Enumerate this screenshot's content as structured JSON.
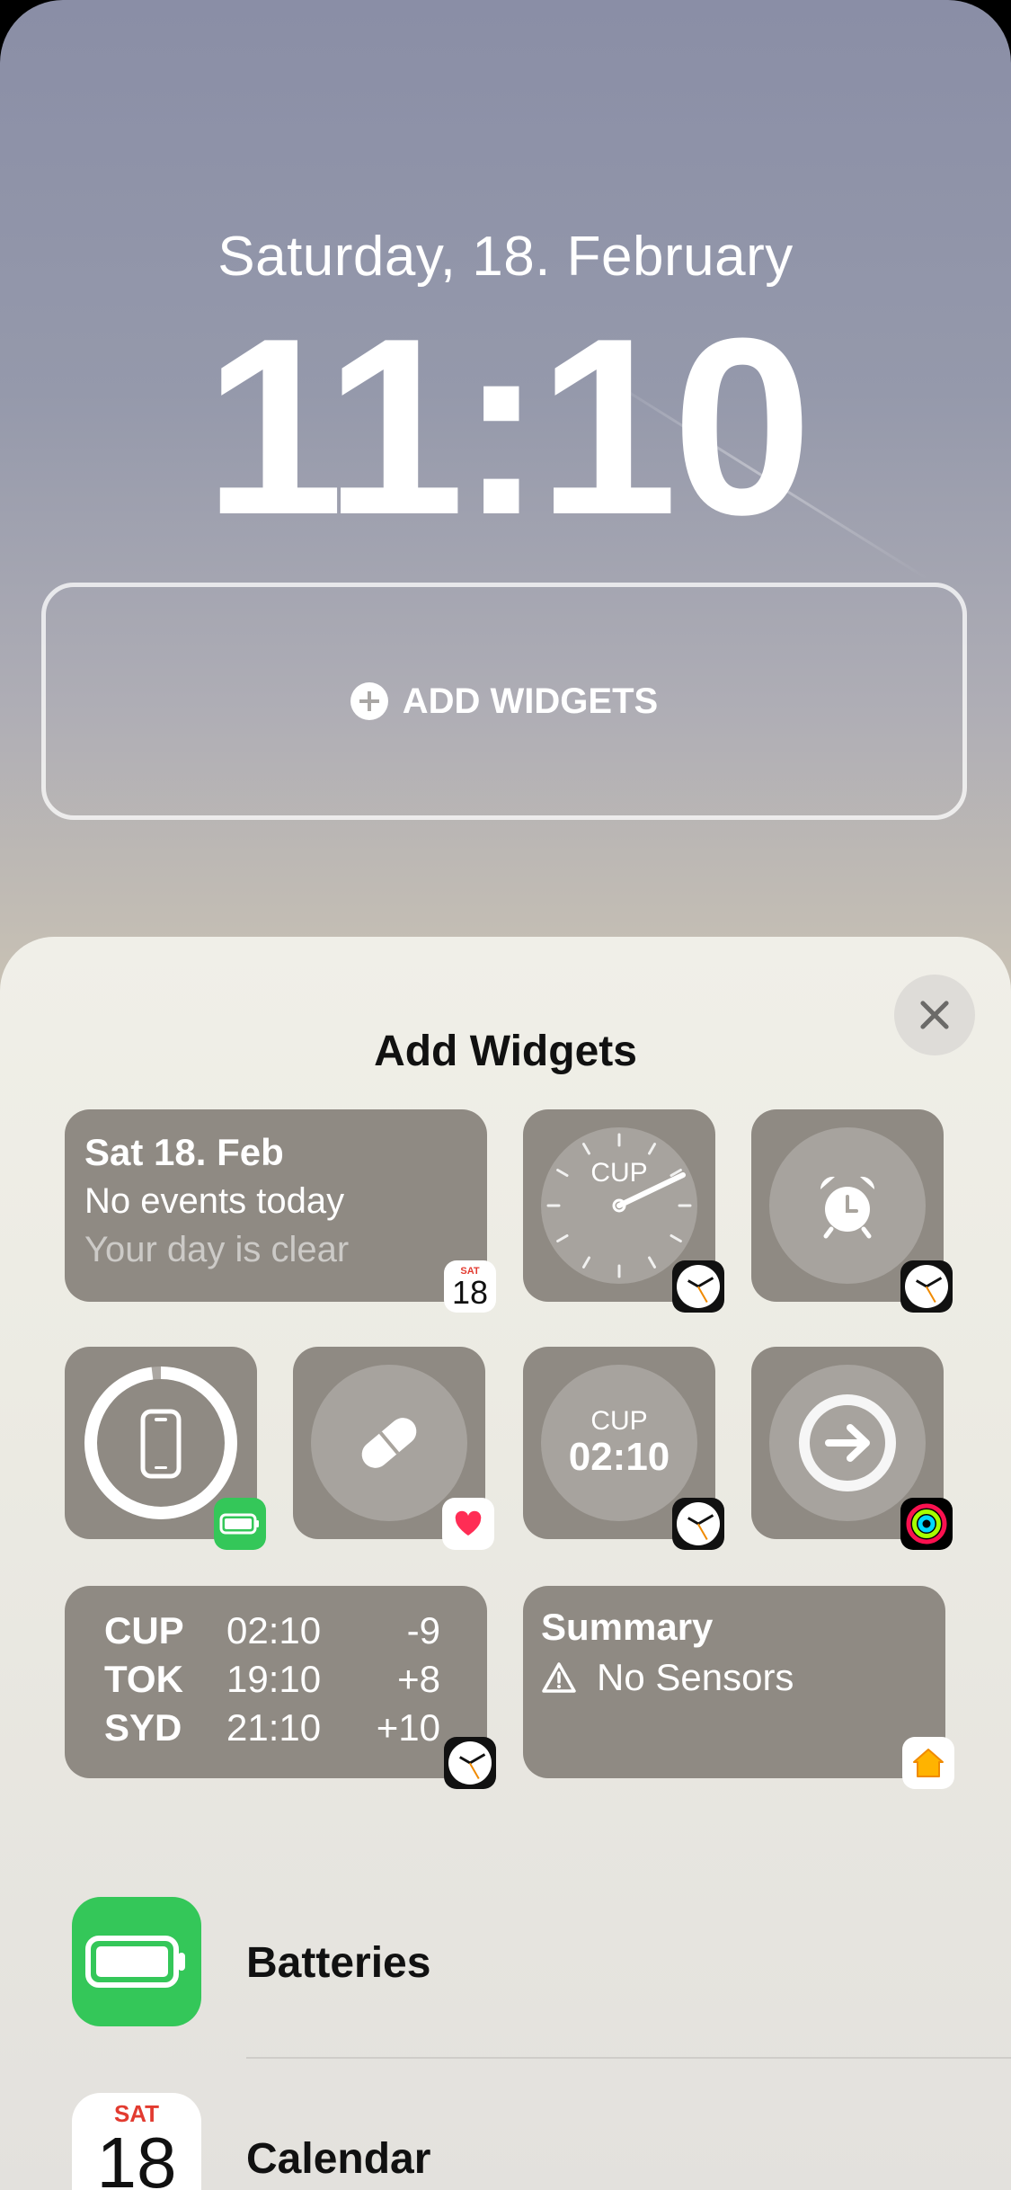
{
  "lockscreen": {
    "date": "Saturday, 18. February",
    "time": "11:10",
    "add_widgets_label": "ADD WIDGETS"
  },
  "sheet": {
    "title": "Add Widgets",
    "close_icon": "close-icon"
  },
  "widgets": {
    "calendar": {
      "date": "Sat 18. Feb",
      "line1": "No events today",
      "line2": "Your day is clear",
      "badge_month": "SAT",
      "badge_day": "18"
    },
    "analog_clock": {
      "city": "CUP"
    },
    "alarm": {
      "icon": "alarm-clock-icon"
    },
    "battery": {
      "icon": "iphone-icon",
      "level": 0.98
    },
    "medications": {
      "icon": "pill-icon"
    },
    "digital_clock": {
      "city": "CUP",
      "time": "02:10"
    },
    "fitness": {
      "icon": "arrow-right-icon"
    },
    "world_clock": {
      "rows": [
        {
          "city": "CUP",
          "time": "02:10",
          "offset": "-9"
        },
        {
          "city": "TOK",
          "time": "19:10",
          "offset": "+8"
        },
        {
          "city": "SYD",
          "time": "21:10",
          "offset": "+10"
        }
      ]
    },
    "home": {
      "title": "Summary",
      "status": "No Sensors"
    }
  },
  "app_list": [
    {
      "label": "Batteries",
      "icon": "battery-icon"
    },
    {
      "label": "Calendar",
      "icon": "calendar-icon",
      "month": "SAT",
      "day": "18"
    }
  ],
  "colors": {
    "battery_green": "#34c759",
    "calendar_red": "#e23b30",
    "widget_fill": "#8f8a83"
  }
}
